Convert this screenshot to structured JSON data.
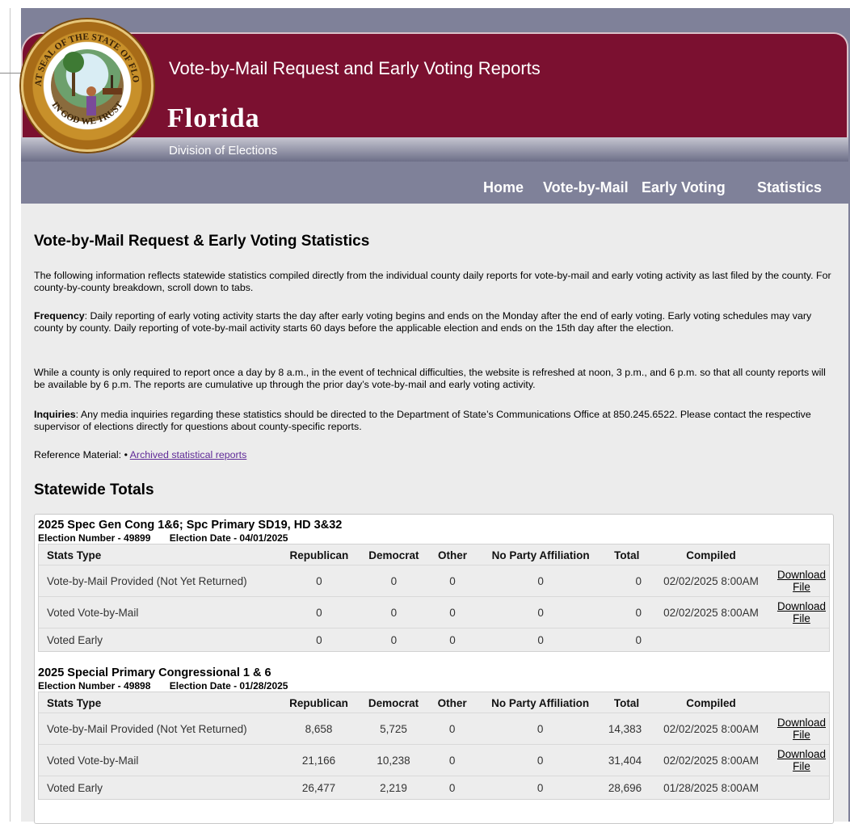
{
  "header": {
    "title": "Vote-by-Mail Request and Early Voting Reports",
    "state": "Florida",
    "division": "Division of Elections",
    "seal_text_top": "GREAT SEAL OF THE STATE OF FLORIDA",
    "seal_text_bottom": "IN GOD WE TRUST"
  },
  "nav": {
    "home": "Home",
    "vote_by_mail": "Vote-by-Mail",
    "early_voting": "Early Voting",
    "statistics": "Statistics"
  },
  "page": {
    "heading": "Vote-by-Mail Request & Early Voting Statistics",
    "intro": "The following information reflects statewide statistics compiled directly from the individual county daily reports for vote-by-mail and early voting activity as last filed by the county. For county-by-county breakdown, scroll down to tabs.",
    "frequency_label": "Frequency",
    "frequency_text": ": Daily reporting of early voting activity starts the day after early voting begins and ends on the Monday after the end of early voting. Early voting schedules may vary county by county. Daily reporting of vote-by-mail activity starts 60 days before the applicable election and ends on the 15th day after the election.",
    "refresh_text": "While a county is only required to report once a day by 8 a.m., in the event of technical difficulties, the website is refreshed at noon, 3 p.m., and 6 p.m. so that all county reports will be available by 6 p.m. The reports are cumulative up through the prior day’s vote-by-mail and early voting activity.",
    "inquiries_label": "Inquiries",
    "inquiries_text": ": Any media inquiries regarding these statistics should be directed to the Department of State’s Communications Office at 850.245.6522. Please contact the respective supervisor of elections directly for questions about county-specific reports.",
    "reference_label": "Reference Material: •",
    "reference_link": "Archived statistical reports",
    "totals_heading": "Statewide Totals"
  },
  "columns": [
    "Stats Type",
    "Republican",
    "Democrat",
    "Other",
    "No Party Affiliation",
    "Total",
    "Compiled",
    ""
  ],
  "elections": [
    {
      "title": "2025 Spec Gen Cong 1&6; Spc Primary SD19, HD 3&32",
      "number_label": "Election Number - 49899",
      "date_label": "Election Date - 04/01/2025",
      "rows": [
        {
          "type": "Vote-by-Mail Provided (Not Yet Returned)",
          "rep": "0",
          "dem": "0",
          "other": "0",
          "npa": "0",
          "total": "0",
          "compiled": "02/02/2025 8:00AM",
          "download": "Download File"
        },
        {
          "type": "Voted Vote-by-Mail",
          "rep": "0",
          "dem": "0",
          "other": "0",
          "npa": "0",
          "total": "0",
          "compiled": "02/02/2025 8:00AM",
          "download": "Download File"
        },
        {
          "type": "Voted Early",
          "rep": "0",
          "dem": "0",
          "other": "0",
          "npa": "0",
          "total": "0",
          "compiled": "",
          "download": ""
        }
      ]
    },
    {
      "title": "2025 Special Primary Congressional 1 & 6",
      "number_label": "Election Number - 49898",
      "date_label": "Election Date - 01/28/2025",
      "rows": [
        {
          "type": "Vote-by-Mail Provided (Not Yet Returned)",
          "rep": "8,658",
          "dem": "5,725",
          "other": "0",
          "npa": "0",
          "total": "14,383",
          "compiled": "02/02/2025 8:00AM",
          "download": "Download File"
        },
        {
          "type": "Voted Vote-by-Mail",
          "rep": "21,166",
          "dem": "10,238",
          "other": "0",
          "npa": "0",
          "total": "31,404",
          "compiled": "02/02/2025 8:00AM",
          "download": "Download File"
        },
        {
          "type": "Voted Early",
          "rep": "26,477",
          "dem": "2,219",
          "other": "0",
          "npa": "0",
          "total": "28,696",
          "compiled": "01/28/2025 8:00AM",
          "download": ""
        }
      ]
    }
  ],
  "colors": {
    "banner": "#7b1030",
    "nav_bar": "#7f8199",
    "content_bg": "#ececec",
    "link": "#5f2a97"
  }
}
